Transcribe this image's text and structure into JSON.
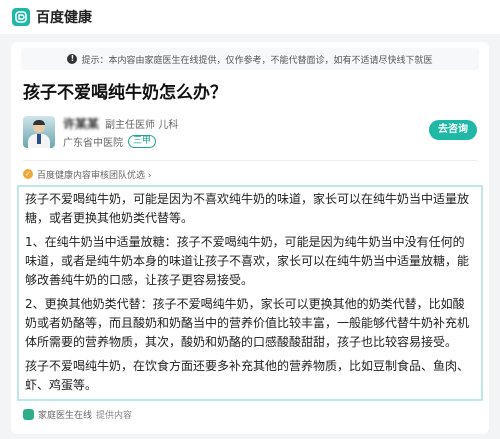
{
  "app": {
    "brand": "百度健康"
  },
  "tip": {
    "text": "提示：本内容由家庭医生在线提供，仅作参考，不能代替面诊，如有不适请尽快线下就医"
  },
  "article": {
    "title": "孩子不爱喝纯牛奶怎么办？"
  },
  "doctor": {
    "name": "许某某",
    "title": "副主任医师 儿科",
    "hospital": "广东省中医院",
    "hospital_level": "三甲",
    "consult_label": "去咨询"
  },
  "review": {
    "text": "百度健康内容审核团队优选 ›"
  },
  "content": {
    "paragraphs": [
      "孩子不爱喝纯牛奶，可能是因为不喜欢纯牛奶的味道，家长可以在纯牛奶当中适量放糖，或者更换其他奶类代替等。",
      "1、在纯牛奶当中适量放糖：孩子不爱喝纯牛奶，可能是因为纯牛奶当中没有任何的味道，或者是纯牛奶本身的味道让孩子不喜欢，家长可以在纯牛奶当中适量放糖，能够改善纯牛奶的口感，让孩子更容易接受。",
      "2、更换其他奶类代替：孩子不爱喝纯牛奶，家长可以更换其他的奶类代替，比如酸奶或者奶酪等，而且酸奶和奶酪当中的营养价值比较丰富，一般能够代替牛奶补充机体所需要的营养物质，其次，酸奶和奶酪的口感酸酸甜甜，孩子也比较容易接受。",
      "孩子不爱喝纯牛奶，在饮食方面还要多补充其他的营养物质，比如豆制食品、鱼肉、虾、鸡蛋等。"
    ]
  },
  "source": {
    "name": "家庭医生在线",
    "provider_label": "提供内容"
  }
}
